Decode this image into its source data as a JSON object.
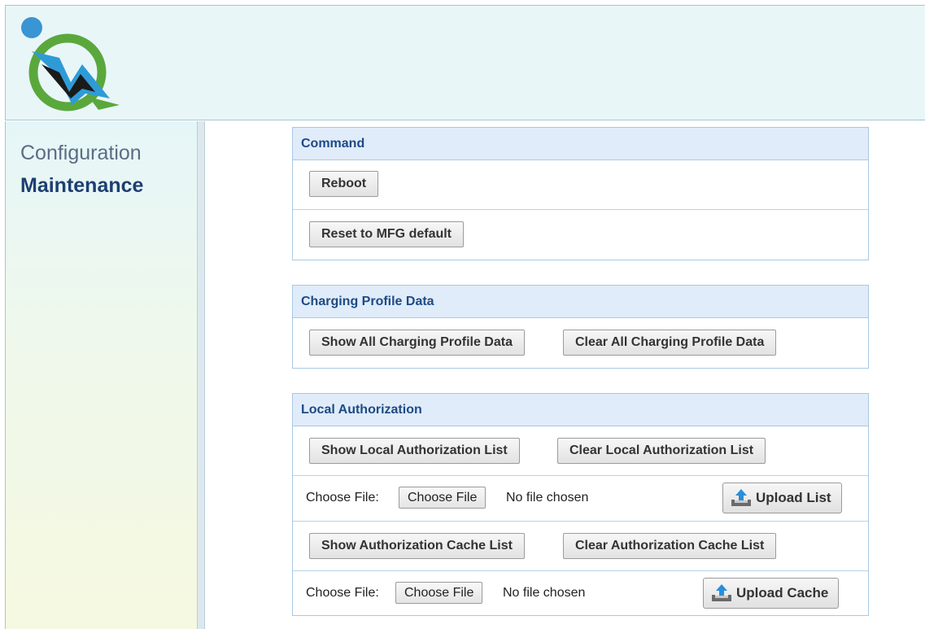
{
  "sidebar": {
    "items": [
      {
        "label": "Configuration"
      },
      {
        "label": "Maintenance"
      }
    ]
  },
  "command": {
    "title": "Command",
    "reboot_label": "Reboot",
    "reset_label": "Reset to MFG default"
  },
  "charging": {
    "title": "Charging Profile Data",
    "show_label": "Show All Charging Profile Data",
    "clear_label": "Clear All Charging Profile Data"
  },
  "local_auth": {
    "title": "Local Authorization",
    "show_list_label": "Show Local Authorization List",
    "clear_list_label": "Clear Local Authorization List",
    "file_row_1": {
      "label": "Choose File:",
      "button": "Choose File",
      "status": "No file chosen",
      "upload_label": "Upload List"
    },
    "show_cache_label": "Show Authorization Cache List",
    "clear_cache_label": "Clear Authorization Cache List",
    "file_row_2": {
      "label": "Choose File:",
      "button": "Choose File",
      "status": "No file chosen",
      "upload_label": "Upload Cache"
    }
  },
  "icons": {
    "logo": "brand-logo",
    "upload": "upload-icon"
  },
  "colors": {
    "header_bg": "#e9f6f8",
    "section_title": "#1e4a86",
    "section_header_bg": "#e0ecf9",
    "nav_active": "#1d3f72",
    "logo_green": "#5aa83c",
    "logo_blue": "#2f9bd6"
  }
}
